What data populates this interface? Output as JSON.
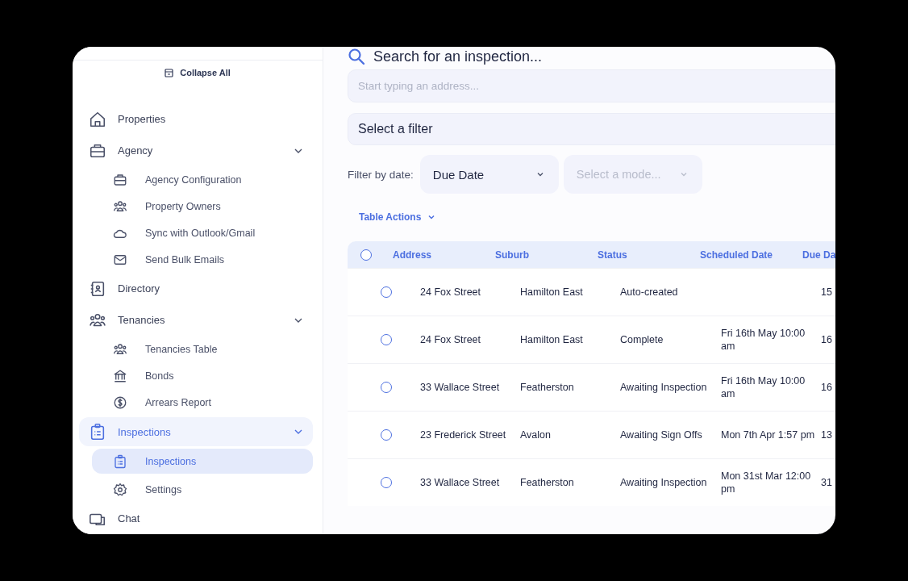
{
  "sidebar": {
    "collapse_all": "Collapse All",
    "items": [
      {
        "label": "Properties",
        "selected": false
      },
      {
        "label": "Agency",
        "selected": false,
        "expanded": true,
        "children": [
          {
            "label": "Agency Configuration",
            "selected": false
          },
          {
            "label": "Property Owners",
            "selected": false
          },
          {
            "label": "Sync with Outlook/Gmail",
            "selected": false
          },
          {
            "label": "Send Bulk Emails",
            "selected": false
          }
        ]
      },
      {
        "label": "Directory",
        "selected": false
      },
      {
        "label": "Tenancies",
        "selected": false,
        "expanded": true,
        "children": [
          {
            "label": "Tenancies Table",
            "selected": false
          },
          {
            "label": "Bonds",
            "selected": false
          },
          {
            "label": "Arrears Report",
            "selected": false
          }
        ]
      },
      {
        "label": "Inspections",
        "selected": true,
        "expanded": true,
        "children": [
          {
            "label": "Inspections",
            "selected": true
          },
          {
            "label": "Settings",
            "selected": false
          }
        ]
      },
      {
        "label": "Chat",
        "selected": false
      }
    ]
  },
  "main": {
    "heading": "Search for an inspection...",
    "search": {
      "placeholder": "Start typing an address..."
    },
    "filter": {
      "value": "Select a filter"
    },
    "date_filter": {
      "label": "Filter by date:",
      "field": {
        "value": "Due Date"
      },
      "mode": {
        "placeholder": "Select a mode..."
      }
    },
    "table_actions": "Table Actions"
  },
  "table": {
    "header_checked": false,
    "columns": [
      "Address",
      "Suburb",
      "Status",
      "Scheduled Date",
      "Due Da"
    ],
    "rows": [
      {
        "checked": false,
        "cells": [
          "24 Fox Street",
          "Hamilton East",
          "Auto-created",
          "",
          "15"
        ]
      },
      {
        "checked": false,
        "cells": [
          "24 Fox Street",
          "Hamilton East",
          "Complete",
          "Fri 16th May 10:00 am",
          "16"
        ]
      },
      {
        "checked": false,
        "cells": [
          "33 Wallace Street",
          "Featherston",
          "Awaiting Inspection",
          "Fri 16th May 10:00 am",
          "16"
        ]
      },
      {
        "checked": false,
        "cells": [
          "23 Frederick Street",
          "Avalon",
          "Awaiting Sign Offs",
          "Mon 7th Apr 1:57 pm",
          "13"
        ]
      },
      {
        "checked": false,
        "cells": [
          "33 Wallace Street",
          "Featherston",
          "Awaiting Inspection",
          "Mon 31st Mar 12:00 pm",
          "31"
        ]
      }
    ]
  }
}
